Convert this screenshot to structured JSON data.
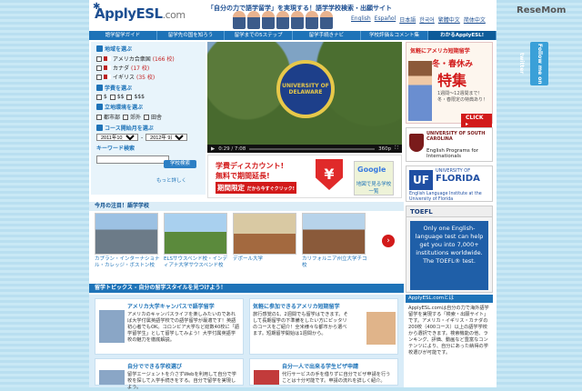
{
  "header": {
    "logo": "ApplyESL",
    "logo_suffix": ".com",
    "tagline": "「自分の力で語学留学」を実現する！語学学校検索・出願サイト",
    "languages": [
      "English",
      "Español",
      "日本語",
      "한국어",
      "繁體中文",
      "简体中文"
    ]
  },
  "nav": [
    "語学留学ガイド",
    "留学先の国を知ろう",
    "留学までの5ステップ",
    "留学手続きナビ",
    "学校評価＆コメント集",
    "わかるApplyESL!"
  ],
  "search": {
    "region_heading": "地域を選ぶ",
    "countries": [
      {
        "name": "アメリカ合衆国",
        "count": "(166 校)"
      },
      {
        "name": "カナダ",
        "count": "(17 校)"
      },
      {
        "name": "イギリス",
        "count": "(35 校)"
      }
    ],
    "fee_heading": "学費を選ぶ",
    "fees": [
      "$",
      "$$",
      "$$$"
    ],
    "env_heading": "立地環境を選ぶ",
    "envs": [
      "都市部",
      "郊外",
      "田舎"
    ],
    "date_heading": "コース開始月を選ぶ",
    "date_from": "2011年10月",
    "date_to": "2012年 9月",
    "keyword_label": "キーワード検索",
    "search_button": "学校検索",
    "more_link": "もっと詳しく"
  },
  "video": {
    "seal_text": "UNIVERSITY OF DELAWARE",
    "time": "0:29 / 7:08",
    "quality": "360p"
  },
  "banner": {
    "line1": "学費ディスカウント!",
    "line2": "無料で期間延長!",
    "line3": "期間限定",
    "line3_sub": "だから今すぐクリック!",
    "yen": "¥",
    "map_label": "地図で見る学校一覧",
    "google": "Google"
  },
  "featured": {
    "heading": "今月の注目！語学学校",
    "items": [
      "カプラン・インターナショナル・カレッジ・ボストン校",
      "ELSサウスベンド校・インディアナ大学サウスベンド校",
      "デポール大学",
      "カリフォルニア州立大学チコ校"
    ],
    "next": "›"
  },
  "topics": {
    "heading": "留学トピックス - 自分の留学スタイルを見つけよう！",
    "cards": [
      {
        "title": "アメリカ大学キャンパスで語学留学",
        "body": "アメリカのキャンパスライフを楽しみたいのであれば大学付属英語学校での語学留学が最適です！英語初心者でもOK。コロンビア大学など総数40校に「語学留学生」として留学してみよう！大学付属英語学校の魅力を徹底解説。"
      },
      {
        "title": "気軽に参加できるアメリカ短期留学",
        "body": "旅行感覚の1、2週間でも留学はできます。そして長期留学の下準備をしたい方にピッタリのコースをご紹介！全米様々な都市から選べます。短期留学開始は1週間から。"
      },
      {
        "title": "自分でできる学校選び",
        "body": "留学エージェントを介さずWebを利用して自分で学校を探して入学手続きをする。自分で留学を実現しよう。"
      },
      {
        "title": "自分一人で出来る学生ビザ申請",
        "body": "代行サービスの手を借りずに自分でビザ申請を行うことは十分可能です。申請の流れを詳しく紹介。"
      }
    ]
  },
  "right": {
    "ad_top": "気軽にアメリカ短期留学",
    "ad_title": "冬・春休み",
    "ad_big": "特集",
    "ad_desc": "1週間〜12週間まで！冬・春限定の特典あり！",
    "ad_click": "CLICK ▸",
    "usc_name": "UNIVERSITY OF SOUTH CAROLINA",
    "usc_sub": "English Programs for Internationals",
    "uf_name": "UNIVERSITY OF",
    "uf_big": "FLORIDA",
    "uf_sub": "English Language Institute at the University of Florida",
    "uf_mark": "UF",
    "toefl": "TOEFL",
    "toefl_ad": "Only one English-language test can help get you into 7,000+ institutions worldwide. The TOEFL® test.",
    "about_heading": "ApplyESL.comとは",
    "about_text": "ApplyESL.comは自分の力で海外語学留学を実現する「検索・出願サイト」です。アメリカ・イギリス・カナダの200校（400コース）以上の語学学校から選択できます。検索機能の他、ランキング、評価、動画など豊富なコンテンツにより、自分にあった納得の学校選びが可能です。"
  },
  "side_tab": "Follow me on twitter",
  "watermark": "ReseMom"
}
